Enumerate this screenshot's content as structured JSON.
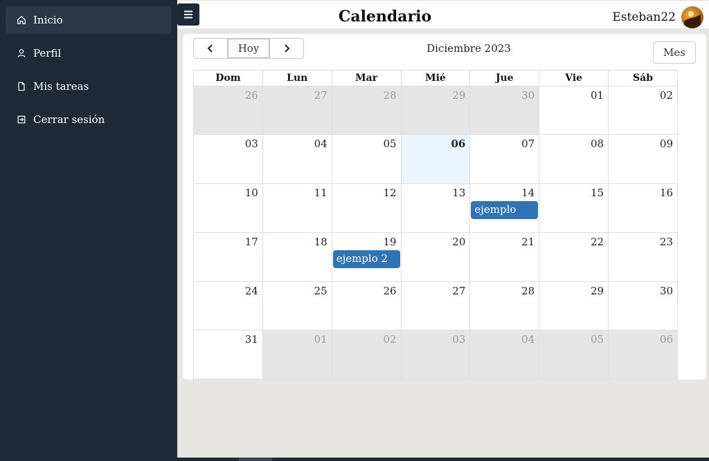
{
  "sidebar": {
    "items": [
      {
        "label": "Inicio",
        "icon": "home-icon",
        "active": true
      },
      {
        "label": "Perfil",
        "icon": "user-icon",
        "active": false
      },
      {
        "label": "Mis tareas",
        "icon": "file-icon",
        "active": false
      },
      {
        "label": "Cerrar sesión",
        "icon": "logout-icon",
        "active": false
      }
    ]
  },
  "header": {
    "title": "Calendario",
    "username": "Esteban22",
    "menu_icon": "hamburger-icon"
  },
  "calendar": {
    "month_label": "Diciembre 2023",
    "today_label": "Hoy",
    "view_label": "Mes",
    "weekdays": [
      "Dom",
      "Lun",
      "Mar",
      "Mié",
      "Jue",
      "Vie",
      "Sáb"
    ],
    "weeks": [
      [
        {
          "d": "26",
          "other": true
        },
        {
          "d": "27",
          "other": true
        },
        {
          "d": "28",
          "other": true
        },
        {
          "d": "29",
          "other": true
        },
        {
          "d": "30",
          "other": true
        },
        {
          "d": "01"
        },
        {
          "d": "02"
        }
      ],
      [
        {
          "d": "03"
        },
        {
          "d": "04"
        },
        {
          "d": "05"
        },
        {
          "d": "06",
          "today": true
        },
        {
          "d": "07"
        },
        {
          "d": "08"
        },
        {
          "d": "09"
        }
      ],
      [
        {
          "d": "10"
        },
        {
          "d": "11"
        },
        {
          "d": "12"
        },
        {
          "d": "13"
        },
        {
          "d": "14",
          "event": "ejemplo"
        },
        {
          "d": "15"
        },
        {
          "d": "16"
        }
      ],
      [
        {
          "d": "17"
        },
        {
          "d": "18"
        },
        {
          "d": "19",
          "event": "ejemplo 2"
        },
        {
          "d": "20"
        },
        {
          "d": "21"
        },
        {
          "d": "22"
        },
        {
          "d": "23"
        }
      ],
      [
        {
          "d": "24"
        },
        {
          "d": "25"
        },
        {
          "d": "26"
        },
        {
          "d": "27"
        },
        {
          "d": "28"
        },
        {
          "d": "29"
        },
        {
          "d": "30"
        }
      ],
      [
        {
          "d": "31"
        },
        {
          "d": "01",
          "other": true
        },
        {
          "d": "02",
          "other": true
        },
        {
          "d": "03",
          "other": true
        },
        {
          "d": "04",
          "other": true
        },
        {
          "d": "05",
          "other": true
        },
        {
          "d": "06",
          "other": true
        }
      ]
    ],
    "colors": {
      "event": "#3273b4",
      "today_bg": "#eaf4fd",
      "other_month_bg": "#e5e5e5"
    }
  }
}
